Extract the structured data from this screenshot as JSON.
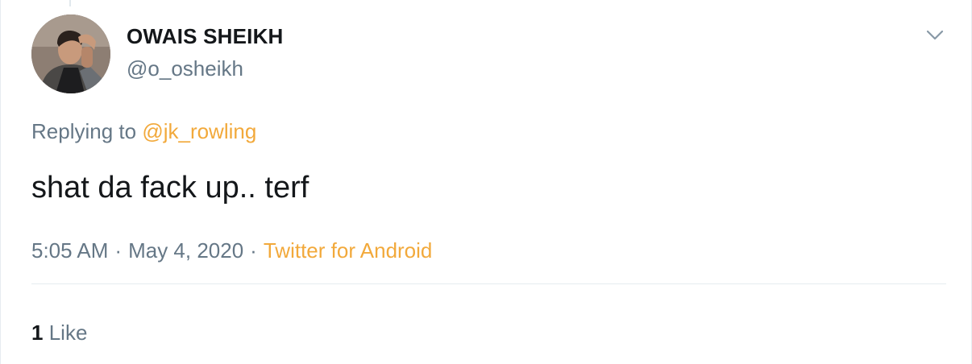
{
  "tweet": {
    "author": {
      "display_name": "OWAIS SHEIKH",
      "handle": "@o_osheikh",
      "avatar_icon": "user-photo-avatar"
    },
    "reply": {
      "prefix": "Replying to",
      "mention": "@jk_rowling"
    },
    "text": "shat da fack up.. terf",
    "time": "5:05 AM",
    "separator": "·",
    "date": "May 4, 2020",
    "source": "Twitter for Android",
    "likes": {
      "count": "1",
      "label": "Like"
    },
    "menu_icon": "chevron-down-icon"
  },
  "colors": {
    "text": "#14171a",
    "secondary": "#657786",
    "accent": "#f2a93b",
    "divider": "#e6ecf0"
  }
}
